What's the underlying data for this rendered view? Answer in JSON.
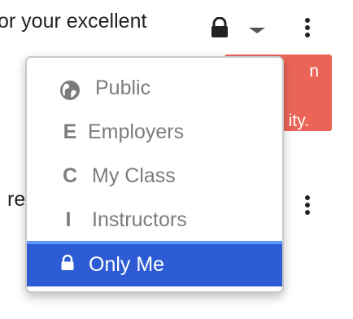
{
  "background": {
    "top_text": "or your excellent",
    "row_text": "re",
    "alert": {
      "line1": "n",
      "line2": "ity."
    }
  },
  "toolbar": {
    "visibility_icon": "lock-icon",
    "dropdown_icon": "caret-down-icon",
    "more_icon": "more-vertical-icon"
  },
  "visibility_menu": {
    "items": [
      {
        "label": "Public",
        "icon": "globe-icon"
      },
      {
        "label": "Employers",
        "icon_text": "E"
      },
      {
        "label": "My Class",
        "icon_text": "C"
      },
      {
        "label": "Instructors",
        "icon_text": "I"
      },
      {
        "label": "Only Me",
        "icon": "lock-icon",
        "selected": true
      }
    ]
  },
  "colors": {
    "selected_bg": "#2c5bd3",
    "selected_border": "#5f99ff",
    "alert_bg": "#ea6557",
    "menu_text": "#7c7c7c"
  }
}
